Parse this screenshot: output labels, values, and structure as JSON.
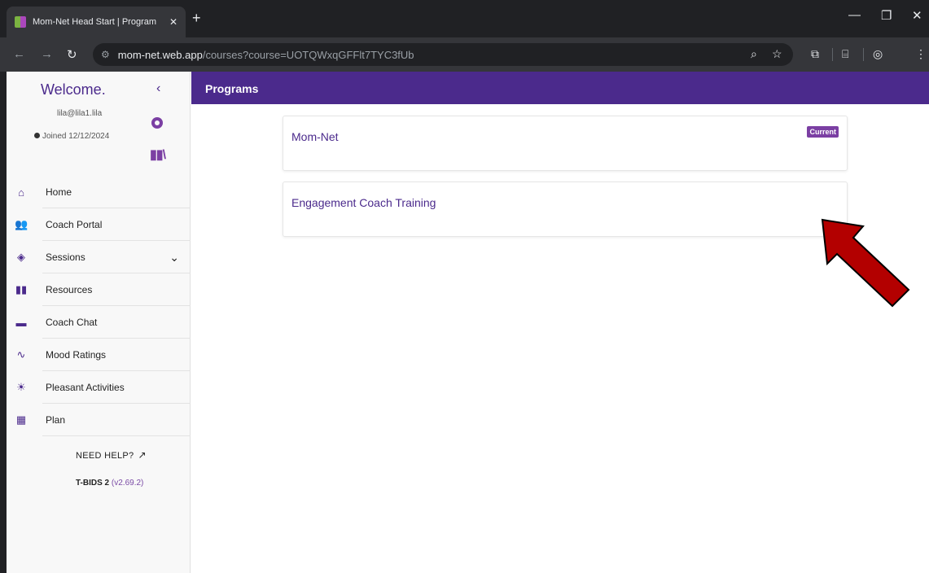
{
  "browser": {
    "tab_title": "Mom-Net Head Start | Program",
    "url_host": "mom-net.web.app",
    "url_path": "/courses?course=UOTQWxqGFFlt7TYC3fUb"
  },
  "sidebar": {
    "welcome": "Welcome.",
    "email": "lila@lila1.lila",
    "joined": "Joined 12/12/2024",
    "items": [
      {
        "label": "Home",
        "icon": "home-icon"
      },
      {
        "label": "Coach Portal",
        "icon": "users-icon"
      },
      {
        "label": "Sessions",
        "icon": "layers-icon"
      },
      {
        "label": "Resources",
        "icon": "book-icon"
      },
      {
        "label": "Coach Chat",
        "icon": "chat-icon"
      },
      {
        "label": "Mood Ratings",
        "icon": "chart-line-icon"
      },
      {
        "label": "Pleasant Activities",
        "icon": "sun-icon"
      },
      {
        "label": "Plan",
        "icon": "calendar-icon"
      }
    ],
    "help": "NEED HELP?",
    "app_name": "T-BIDS 2",
    "version": "(v2.69.2)"
  },
  "header": {
    "title": "Programs"
  },
  "programs": [
    {
      "name": "Mom-Net",
      "badge": "Current"
    },
    {
      "name": "Engagement Coach Training"
    }
  ],
  "colors": {
    "brand": "#4b2a8c",
    "accent": "#7b3fa3",
    "arrow": "#b30000"
  }
}
